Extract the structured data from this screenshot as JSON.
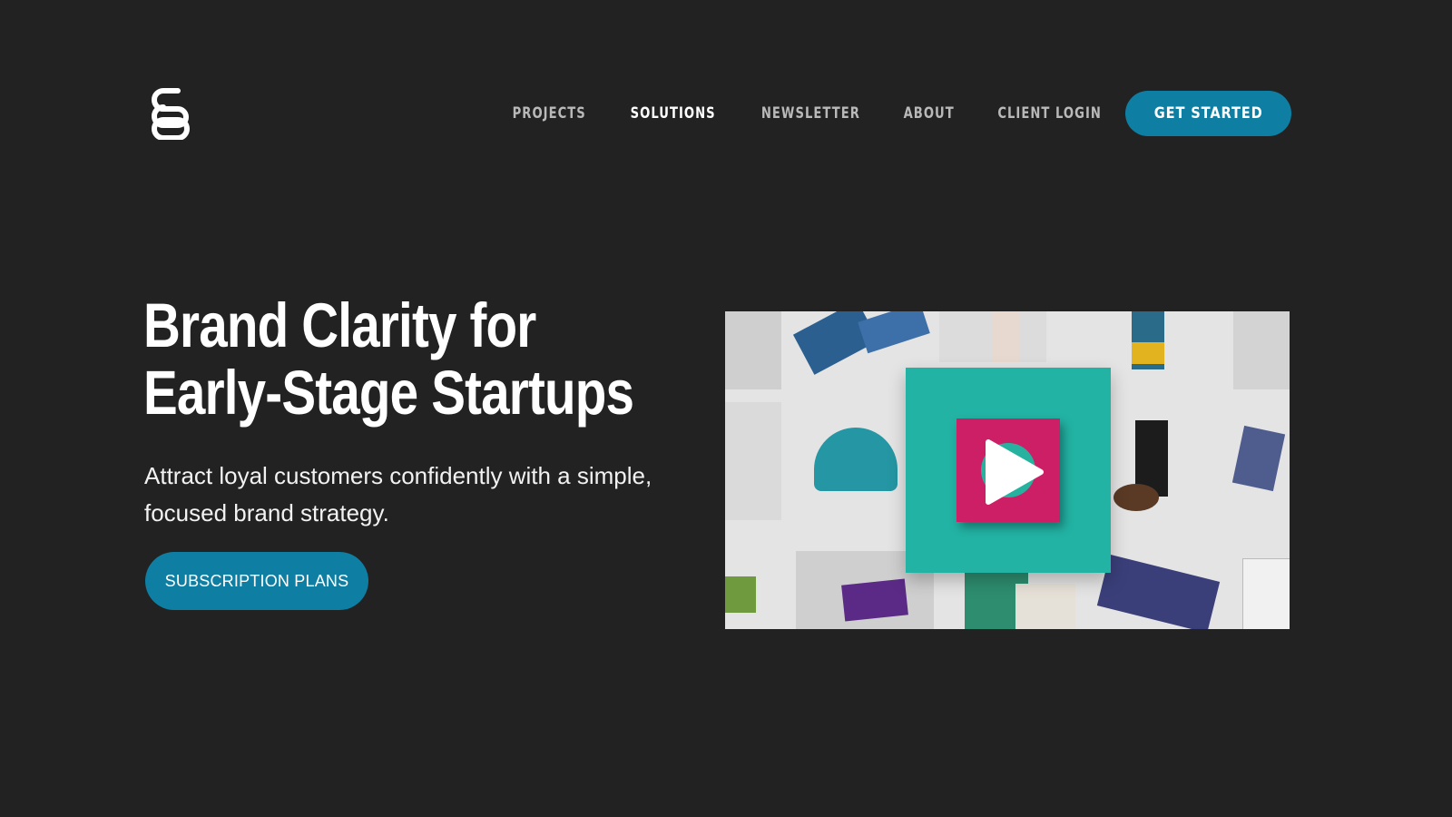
{
  "brand": {
    "logo_icon": "brand-logo-icon"
  },
  "nav": {
    "items": [
      {
        "label": "PROJECTS",
        "active": false
      },
      {
        "label": "SOLUTIONS",
        "active": true
      },
      {
        "label": "NEWSLETTER",
        "active": false
      },
      {
        "label": "ABOUT",
        "active": false
      },
      {
        "label": "CLIENT LOGIN",
        "active": false
      }
    ],
    "cta_label": "GET STARTED"
  },
  "hero": {
    "title_line1": "Brand Clarity for",
    "title_line2": "Early-Stage Startups",
    "subtitle": "Attract loyal customers confidently with a simple, focused brand strategy.",
    "cta_label": "SUBSCRIPTION PLANS"
  },
  "video": {
    "icon": "play-icon"
  },
  "colors": {
    "background": "#222222",
    "accent": "#0e7fa3",
    "text_primary": "#ffffff",
    "nav_text": "#b9b9b9"
  }
}
